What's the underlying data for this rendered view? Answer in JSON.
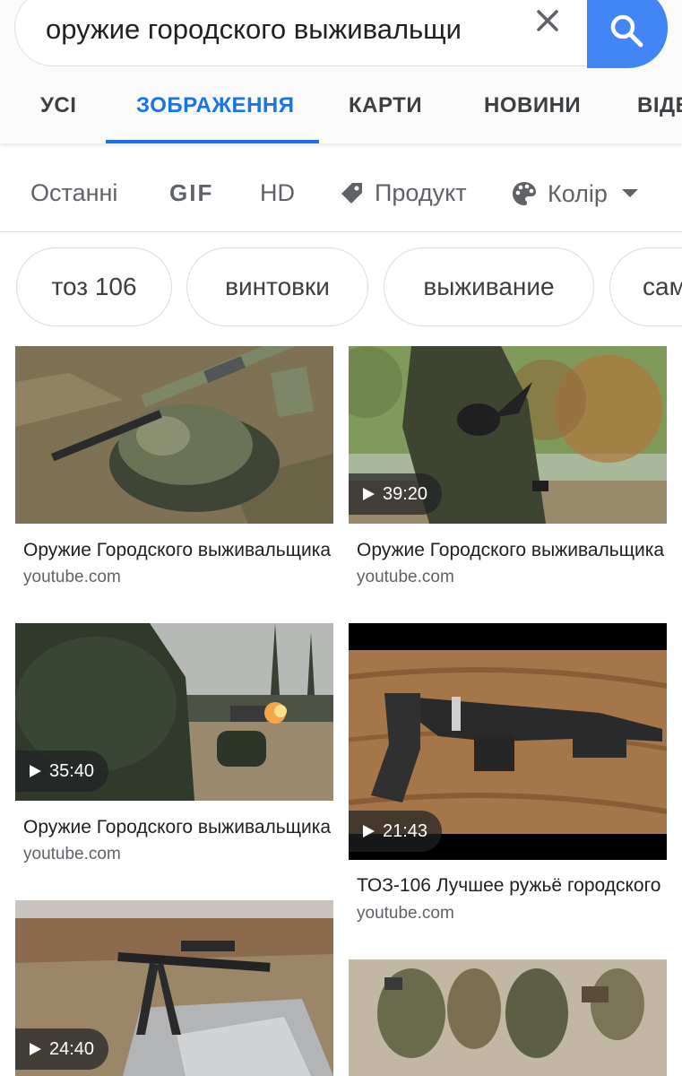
{
  "search": {
    "query": "оружие городского выживальщи"
  },
  "tabs": [
    {
      "label": "УСІ"
    },
    {
      "label": "ЗОБРАЖЕННЯ"
    },
    {
      "label": "КАРТИ"
    },
    {
      "label": "НОВИНИ"
    },
    {
      "label": "ВІДЕО"
    }
  ],
  "filters": {
    "recent": "Останні",
    "gif": "GIF",
    "hd": "HD",
    "product": "Продукт",
    "color": "Колір"
  },
  "chips": [
    "тоз 106",
    "винтовки",
    "выживание",
    "сам"
  ],
  "results": [
    {
      "title": "Оружие Городского выживальщика",
      "source": "youtube.com",
      "duration": ""
    },
    {
      "title": "Оружие Городского выживальщика",
      "source": "youtube.com",
      "duration": "39:20"
    },
    {
      "title": "Оружие Городского выживальщика",
      "source": "youtube.com",
      "duration": "35:40"
    },
    {
      "title": "ТОЗ-106 Лучшее ружьё городского",
      "source": "youtube.com",
      "duration": "21:43"
    },
    {
      "title": "",
      "source": "",
      "duration": "24:40"
    },
    {
      "title": "",
      "source": "",
      "duration": ""
    }
  ],
  "colors": {
    "accent": "#1a73e8",
    "search_button": "#4285f4"
  }
}
